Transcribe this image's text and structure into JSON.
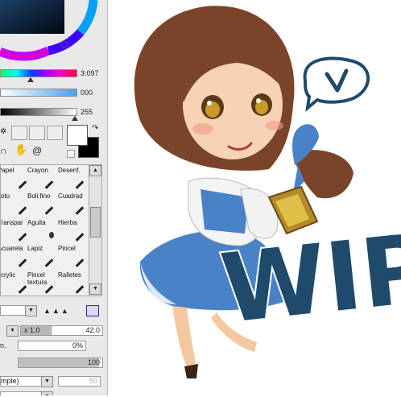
{
  "color_panel": {
    "hue_value": "3:097",
    "saturation_value": "000",
    "value_value": "255"
  },
  "tools": [
    {
      "label": "Papel"
    },
    {
      "label": "Crayon"
    },
    {
      "label": "Desenf."
    },
    {
      "label": "otu"
    },
    {
      "label": "Boli fino"
    },
    {
      "label": "Cuadrad"
    },
    {
      "label": "Transpar"
    },
    {
      "label": "Aguita"
    },
    {
      "label": "Hierba"
    },
    {
      "label": "Acuarela"
    },
    {
      "label": "Lapiz"
    },
    {
      "label": "Pincel"
    },
    {
      "label": "crylic"
    },
    {
      "label": "Pincel textura"
    },
    {
      "label": "Ralletes"
    }
  ],
  "brush": {
    "size_multiplier": "x 1.0",
    "size_value": "42.0",
    "min_size_label": "n.",
    "min_size_value": "0%",
    "density_value": "100",
    "blending_mode": "mple)",
    "blending_value": "50"
  },
  "canvas": {
    "wip_text": "WIP"
  },
  "colors": {
    "dress_blue": "#4a82c8",
    "wip_blue": "#1f4a6b",
    "hair_brown": "#7a4428"
  }
}
